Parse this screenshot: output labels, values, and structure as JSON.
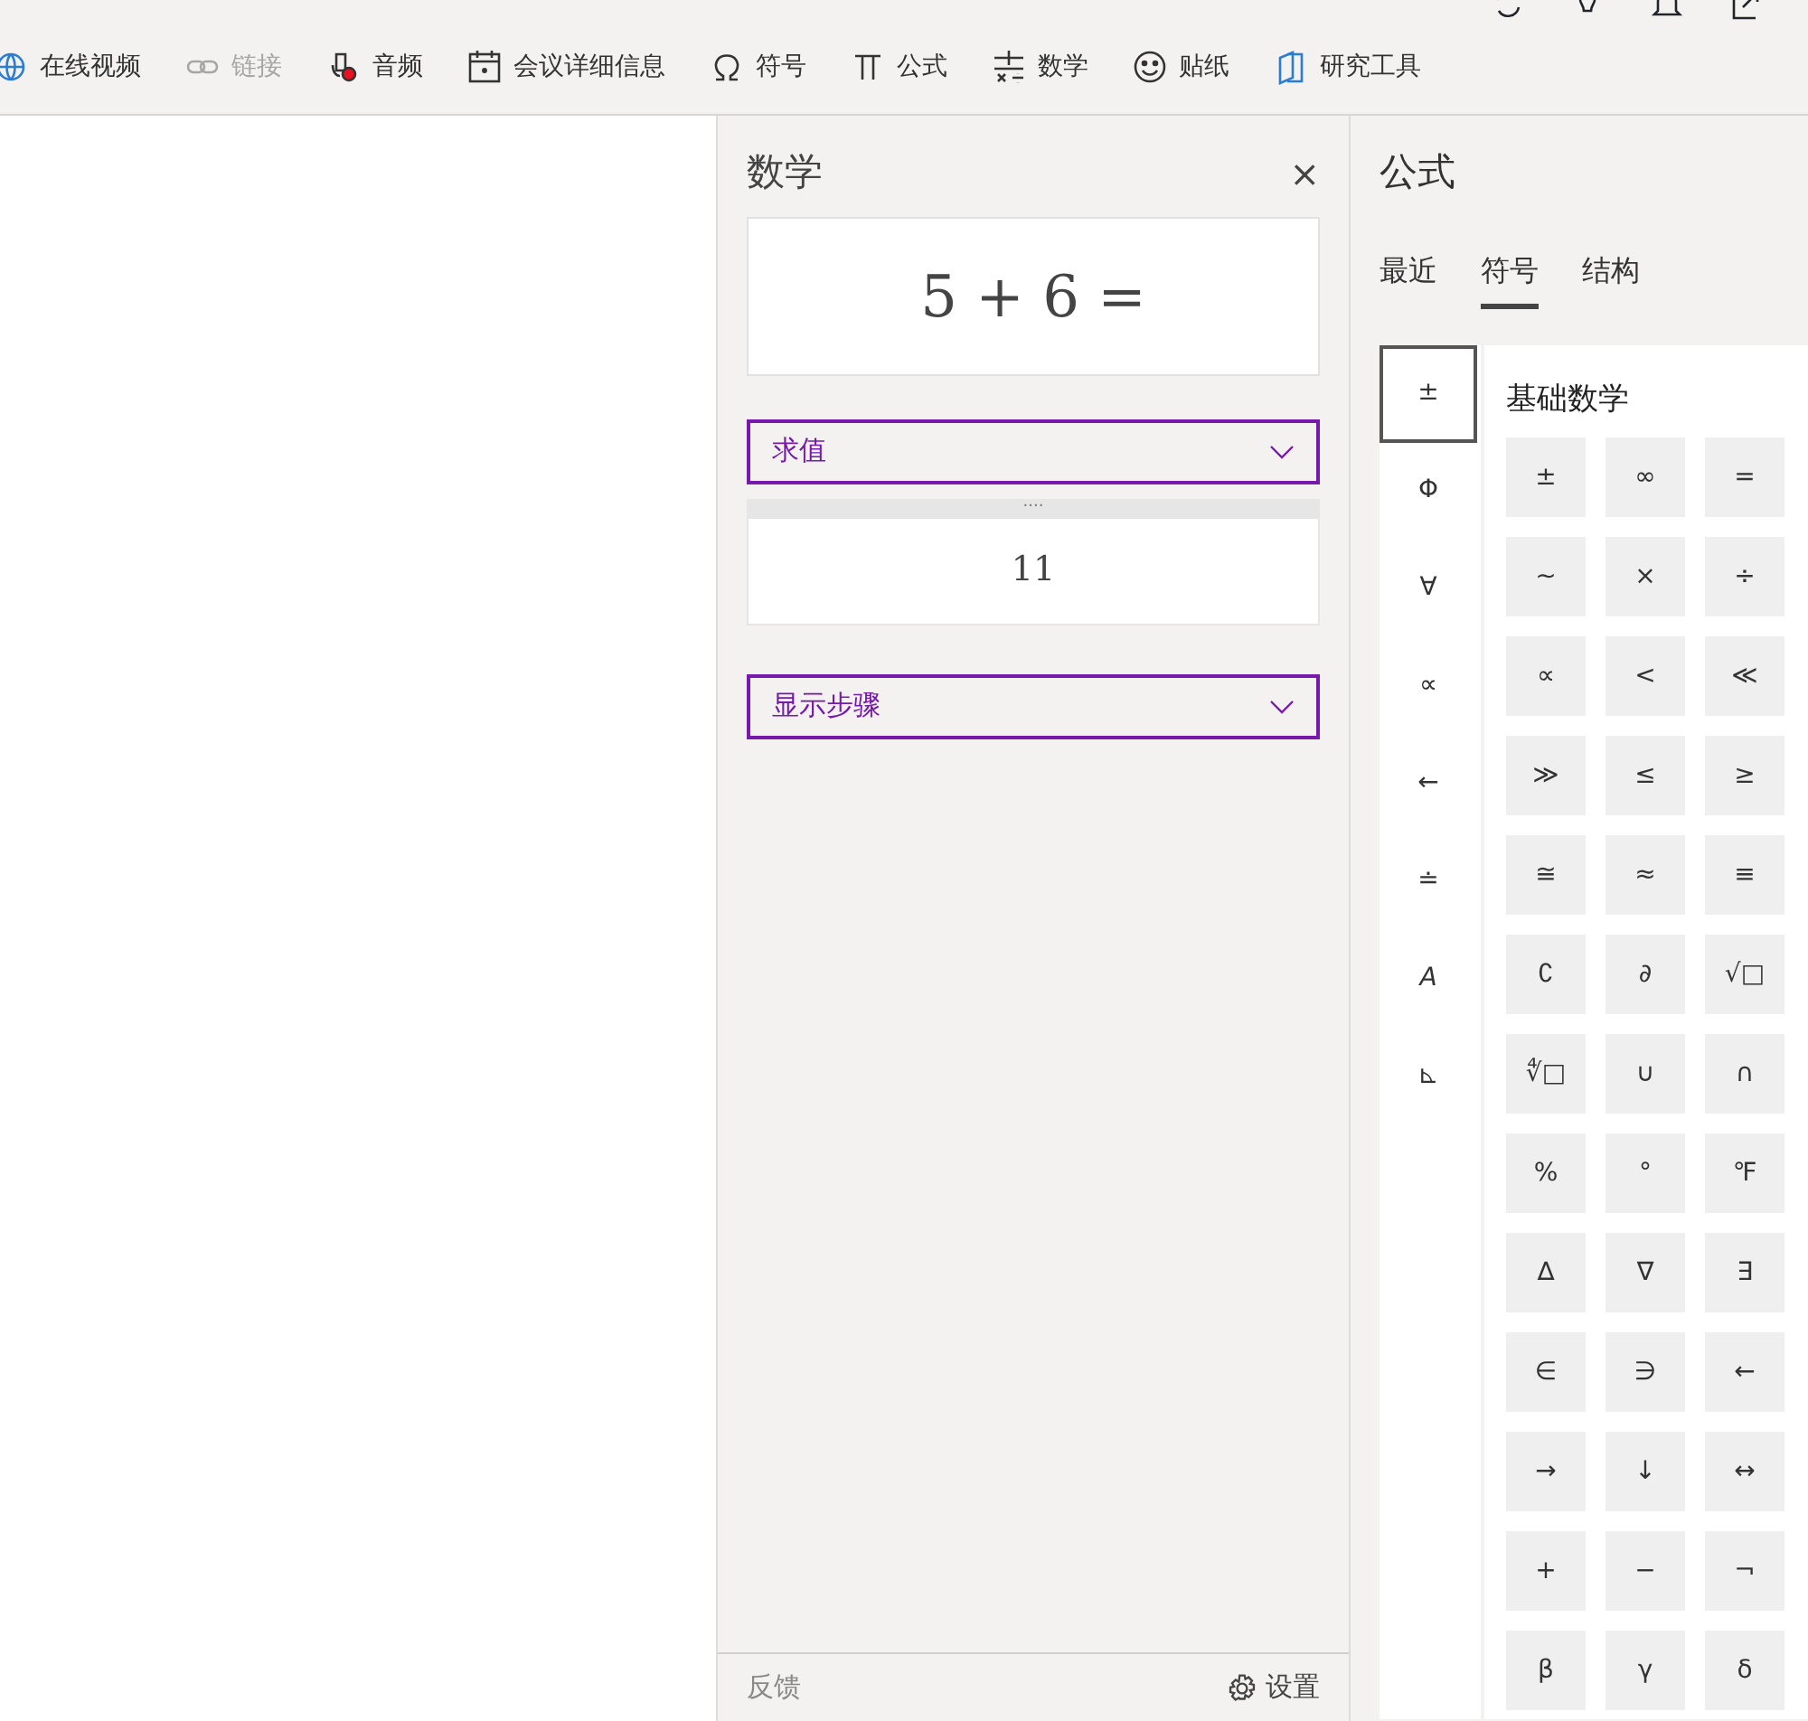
{
  "ribbon": {
    "items": [
      {
        "label": "在线视频",
        "kind": "globe",
        "disabled": false
      },
      {
        "label": "链接",
        "kind": "link",
        "disabled": true
      },
      {
        "label": "音频",
        "kind": "audio",
        "disabled": false
      },
      {
        "label": "会议详细信息",
        "kind": "calendar",
        "disabled": false
      },
      {
        "label": "符号",
        "kind": "omega",
        "disabled": false
      },
      {
        "label": "公式",
        "kind": "pi",
        "disabled": false
      },
      {
        "label": "数学",
        "kind": "math",
        "disabled": false
      },
      {
        "label": "贴纸",
        "kind": "smiley",
        "disabled": false
      },
      {
        "label": "研究工具",
        "kind": "research",
        "disabled": false
      }
    ]
  },
  "math_panel": {
    "title": "数学",
    "close": "×",
    "expression": "5 + 6 =",
    "action": {
      "label": "求值"
    },
    "result_handle": "....",
    "result": "11",
    "steps": {
      "label": "显示步骤"
    },
    "feedback": "反馈",
    "settings": "设置"
  },
  "equation_panel": {
    "title": "公式",
    "tabs": [
      {
        "label": "最近",
        "selected": false
      },
      {
        "label": "符号",
        "selected": true
      },
      {
        "label": "结构",
        "selected": false
      }
    ],
    "categories": [
      {
        "symbol": "±",
        "selected": true
      },
      {
        "symbol": "Φ",
        "selected": false
      },
      {
        "symbol": "∀",
        "selected": false
      },
      {
        "symbol": "∝",
        "selected": false
      },
      {
        "symbol": "←",
        "selected": false
      },
      {
        "symbol": "≐",
        "selected": false
      },
      {
        "symbol": "A",
        "selected": false
      },
      {
        "symbol": "⊾",
        "selected": false
      }
    ],
    "section_title": "基础数学",
    "symbols": [
      "±",
      "∞",
      "=",
      "~",
      "×",
      "÷",
      "∝",
      "<",
      "≪",
      "≫",
      "≤",
      "≥",
      "≅",
      "≈",
      "≡",
      "∁",
      "∂",
      "√□",
      "∜□",
      "∪",
      "∩",
      "%",
      "°",
      "℉",
      "∆",
      "∇",
      "∃",
      "∈",
      "∋",
      "←",
      "→",
      "↓",
      "↔",
      "+",
      "−",
      "¬",
      "β",
      "γ",
      "δ"
    ]
  }
}
